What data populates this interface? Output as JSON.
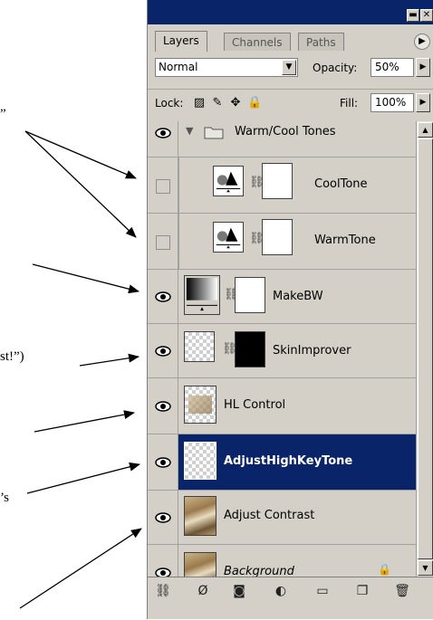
{
  "annotations": [
    {
      "text": "”"
    },
    {
      "text": "st!”)"
    },
    {
      "text": "’s"
    }
  ],
  "panel": {
    "tabs": [
      {
        "label": "Layers"
      },
      {
        "label": "Channels"
      },
      {
        "label": "Paths"
      }
    ],
    "blend_mode": "Normal",
    "opacity_label": "Opacity:",
    "opacity_value": "50%",
    "lock_label": "Lock:",
    "fill_label": "Fill:",
    "fill_value": "100%"
  },
  "layers": [
    {
      "name": "Warm/Cool Tones",
      "kind": "group",
      "visible": true
    },
    {
      "name": "CoolTone",
      "kind": "adjustment",
      "visible": false
    },
    {
      "name": "WarmTone",
      "kind": "adjustment",
      "visible": false
    },
    {
      "name": "MakeBW",
      "kind": "adjustment",
      "visible": true
    },
    {
      "name": "SkinImprover",
      "kind": "masked",
      "visible": true
    },
    {
      "name": "HL Control",
      "kind": "pixel",
      "visible": true
    },
    {
      "name": "AdjustHighKeyTone",
      "kind": "pixel",
      "visible": true,
      "selected": true
    },
    {
      "name": "Adjust Contrast",
      "kind": "pixel",
      "visible": true
    },
    {
      "name": "Background",
      "kind": "background",
      "visible": true,
      "locked": true
    }
  ],
  "colors": {
    "selection": "#0a246a",
    "panel": "#d4d0c8"
  }
}
